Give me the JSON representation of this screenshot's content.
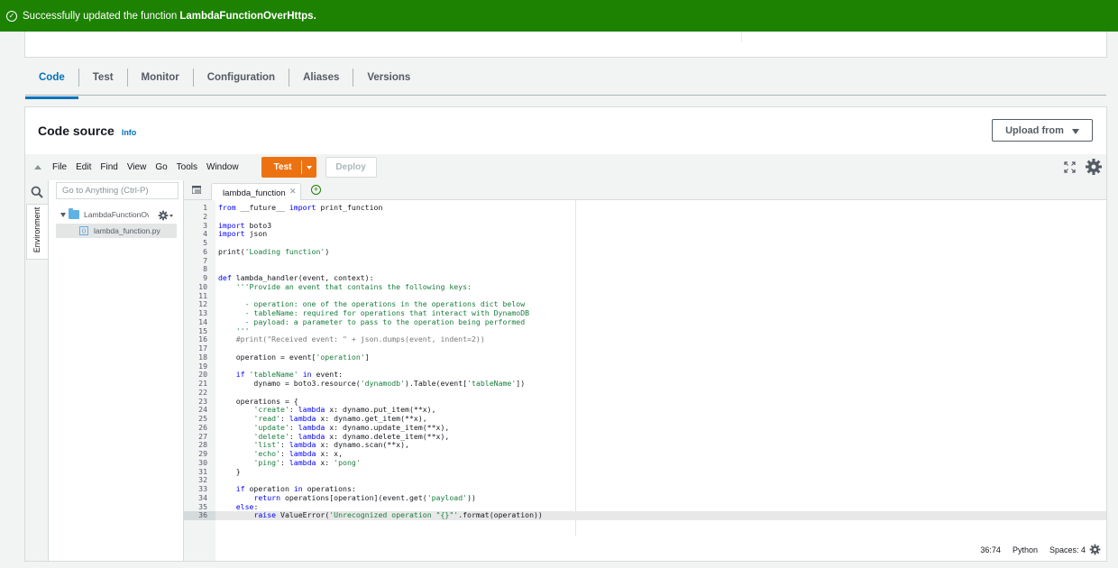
{
  "flash": {
    "message": "Successfully updated the function",
    "function_name": "LambdaFunctionOverHttps."
  },
  "tabs": [
    {
      "label": "Code",
      "active": true
    },
    {
      "label": "Test"
    },
    {
      "label": "Monitor"
    },
    {
      "label": "Configuration"
    },
    {
      "label": "Aliases"
    },
    {
      "label": "Versions"
    }
  ],
  "code_source": {
    "title": "Code source",
    "info_label": "Info",
    "upload_label": "Upload from"
  },
  "ide_menu": [
    "File",
    "Edit",
    "Find",
    "View",
    "Go",
    "Tools",
    "Window"
  ],
  "test_label": "Test",
  "deploy_label": "Deploy",
  "goto_placeholder": "Go to Anything (Ctrl-P)",
  "environment_label": "Environment",
  "tree": {
    "folder": "LambdaFunctionOverHttps",
    "file": "lambda_function.py"
  },
  "editor_tab": "lambda_function",
  "code_lines": [
    "from __future__ import print_function",
    "",
    "import boto3",
    "import json",
    "",
    "print('Loading function')",
    "",
    "",
    "def lambda_handler(event, context):",
    "    '''Provide an event that contains the following keys:",
    "",
    "      - operation: one of the operations in the operations dict below",
    "      - tableName: required for operations that interact with DynamoDB",
    "      - payload: a parameter to pass to the operation being performed",
    "    '''",
    "    #print(\"Received event: \" + json.dumps(event, indent=2))",
    "",
    "    operation = event['operation']",
    "",
    "    if 'tableName' in event:",
    "        dynamo = boto3.resource('dynamodb').Table(event['tableName'])",
    "",
    "    operations = {",
    "        'create': lambda x: dynamo.put_item(**x),",
    "        'read': lambda x: dynamo.get_item(**x),",
    "        'update': lambda x: dynamo.update_item(**x),",
    "        'delete': lambda x: dynamo.delete_item(**x),",
    "        'list': lambda x: dynamo.scan(**x),",
    "        'echo': lambda x: x,",
    "        'ping': lambda x: 'pong'",
    "    }",
    "",
    "    if operation in operations:",
    "        return operations[operation](event.get('payload'))",
    "    else:",
    "        raise ValueError('Unrecognized operation \"{}\"'.format(operation))"
  ],
  "current_line": 36,
  "status": {
    "position": "36:74",
    "language": "Python",
    "spaces": "Spaces: 4"
  },
  "colors": {
    "flash_green": "#1d8102",
    "accent_blue": "#0073bb",
    "test_orange": "#ec7211"
  }
}
